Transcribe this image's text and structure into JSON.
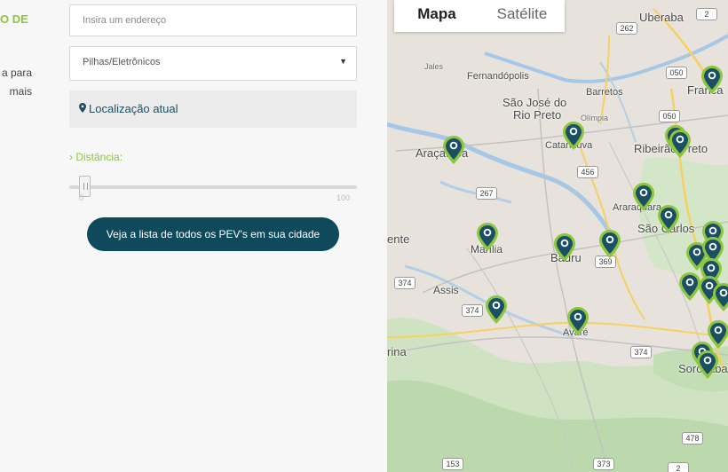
{
  "form": {
    "title": "O DE",
    "desc_line1": "a para",
    "desc_line2": "mais",
    "address_placeholder": "Insira um endereço",
    "category_selected": "Pilhas/Eletrônicos",
    "location_label": "Localização atual",
    "distance_label": "Distância:",
    "slider_min": "0",
    "slider_max": "100",
    "slider_value": 5,
    "list_button": "Veja a lista de todos os PEV's em sua cidade"
  },
  "map": {
    "tabs": [
      "Mapa",
      "Satélite"
    ],
    "active_tab": "Mapa",
    "cities": {
      "uberaba": "Uberaba",
      "jales": "Jales",
      "fernandopolis": "Fernandópolis",
      "sjrp1": "São José do",
      "sjrp2": "Rio Preto",
      "barretos": "Barretos",
      "franca": "Franca",
      "olimpia": "Olímpia",
      "catanduva": "Catanduva",
      "ribeirao": "Ribeirão Preto",
      "aracatuba": "Araçatuba",
      "araraquara": "Araraquara",
      "saocarlos": "São Carlos",
      "ente": "ente",
      "marilia": "Marília",
      "bauru": "Bauru",
      "assis": "Assis",
      "avare": "Avaré",
      "rina": "rina",
      "sorocaba": "Sorocaba"
    },
    "roads": {
      "r262": "262",
      "r050a": "050",
      "r050b": "050",
      "r456": "456",
      "r267": "267",
      "r369": "369",
      "r374a": "374",
      "r374b": "374",
      "r374c": "374",
      "r478": "478",
      "r153": "153",
      "r373": "373",
      "r2a": "2",
      "r2b": "2"
    },
    "marker_color": "#1b4f63",
    "marker_ring": "#8cc63f"
  }
}
